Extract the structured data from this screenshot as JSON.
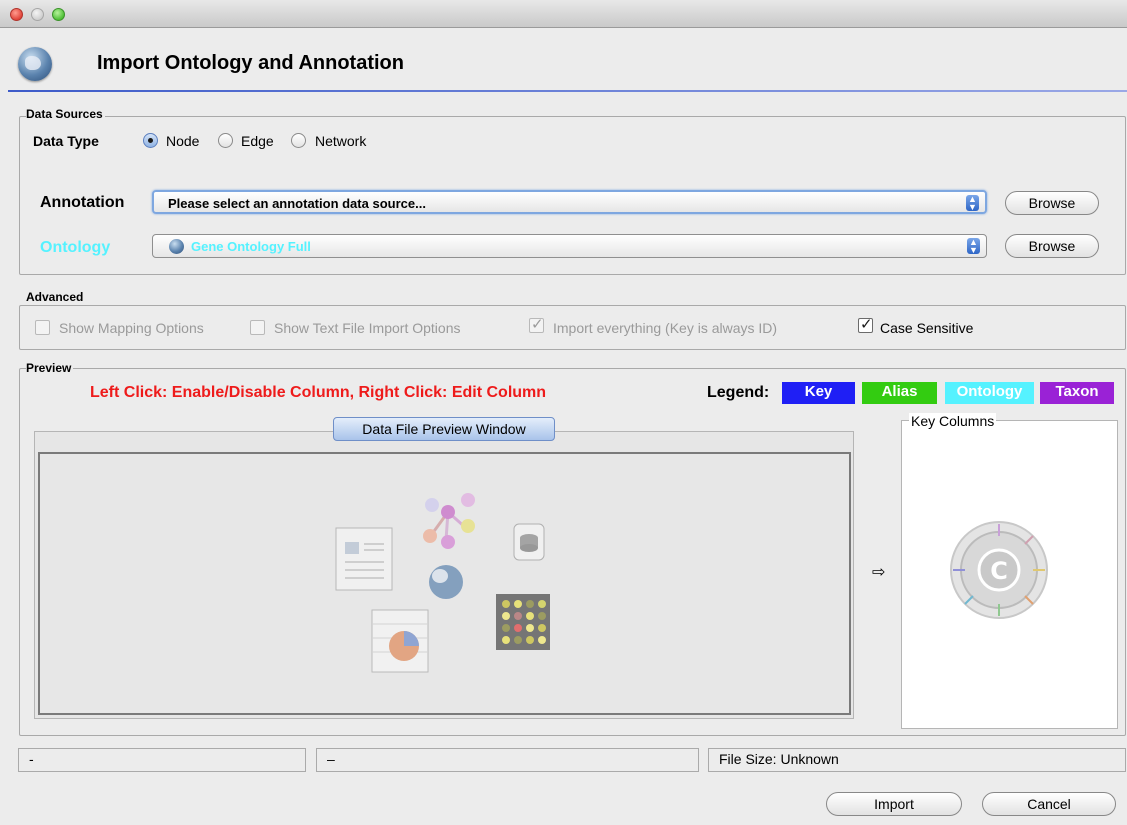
{
  "window": {
    "title": "Import Ontology and Annotation"
  },
  "data_sources": {
    "group_label": "Data Sources",
    "data_type_label": "Data Type",
    "data_type_options": [
      {
        "label": "Node",
        "selected": true
      },
      {
        "label": "Edge",
        "selected": false
      },
      {
        "label": "Network",
        "selected": false
      }
    ],
    "annotation_label": "Annotation",
    "annotation_value": "Please select an annotation data source...",
    "ontology_label": "Ontology",
    "ontology_value": "Gene Ontology Full",
    "browse_label": "Browse"
  },
  "advanced": {
    "group_label": "Advanced",
    "options": [
      {
        "label": "Show Mapping Options",
        "checked": false,
        "enabled": false
      },
      {
        "label": "Show Text File Import Options",
        "checked": false,
        "enabled": false
      },
      {
        "label": "Import everything (Key is always ID)",
        "checked": true,
        "enabled": false
      },
      {
        "label": "Case Sensitive",
        "checked": true,
        "enabled": true
      }
    ]
  },
  "preview": {
    "group_label": "Preview",
    "instruction": "Left Click: Enable/Disable Column, Right Click: Edit Column",
    "legend_label": "Legend:",
    "legend_items": [
      {
        "label": "Key",
        "color": "#1f1ff5"
      },
      {
        "label": "Alias",
        "color": "#33cc11"
      },
      {
        "label": "Ontology",
        "color": "#55f2ff"
      },
      {
        "label": "Taxon",
        "color": "#9a22d6"
      }
    ],
    "window_button": "Data File Preview Window",
    "key_columns_label": "Key Columns"
  },
  "status_bar": {
    "field1": "-",
    "field2": "–",
    "file_size": "File Size: Unknown"
  },
  "buttons": {
    "import": "Import",
    "cancel": "Cancel"
  },
  "colors": {
    "instruction": "#ee1b1b",
    "ontology_label": "#55f2ff",
    "accent_line": "#3d5bc9"
  }
}
